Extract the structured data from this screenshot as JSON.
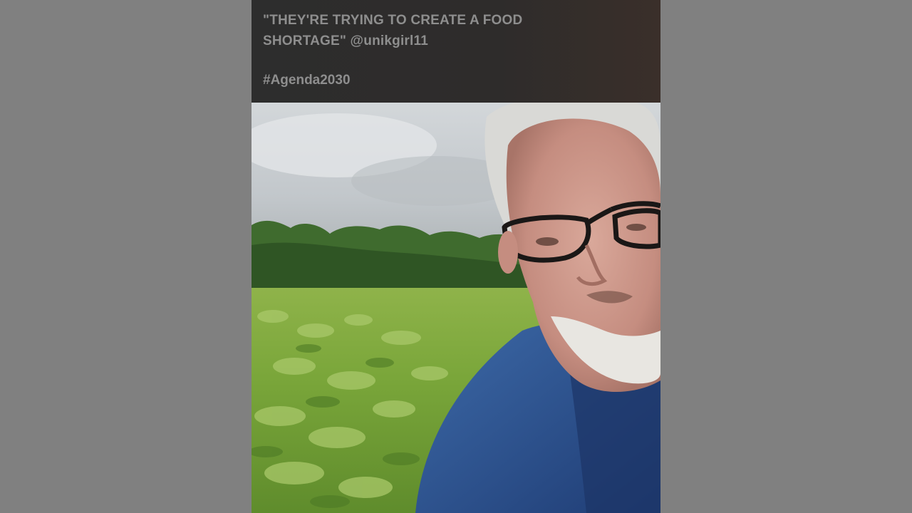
{
  "post": {
    "caption_line_1": "\"THEY'RE TRYING TO CREATE A FOOD",
    "caption_line_2": "SHORTAGE\" @unikgirl11",
    "hashtag": "#Agenda2030"
  },
  "video": {
    "scene": "selfie-video-in-crop-field"
  },
  "colors": {
    "background": "#808080",
    "caption_bar": "#2d2d2d",
    "caption_text": "#8e8e8e"
  }
}
